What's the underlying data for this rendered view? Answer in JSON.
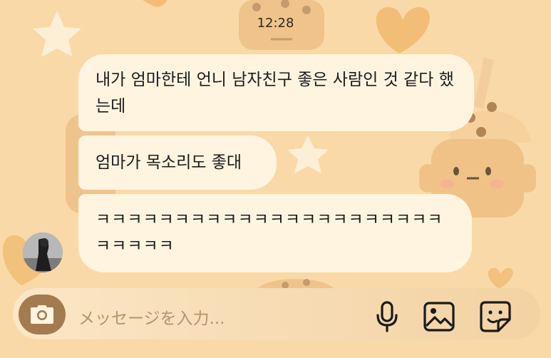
{
  "status": {
    "time": "12:28"
  },
  "messages": [
    {
      "text": "내가 엄마한테 언니 남자친구 좋은 사람인 것 같다 했는데"
    },
    {
      "text": "엄마가 목소리도 좋대"
    },
    {
      "text": "ㅋㅋㅋㅋㅋㅋㅋㅋㅋㅋㅋㅋㅋㅋㅋㅋㅋㅋㅋㅋㅋㅋㅋㅋㅋㅋㅋ"
    }
  ],
  "composer": {
    "placeholder": "メッセージを入力...",
    "icons": [
      "camera-icon",
      "microphone-icon",
      "gallery-icon",
      "sticker-icon"
    ]
  },
  "colors": {
    "background": "#f9d9a8",
    "bubble": "#fff4df",
    "camera_button": "#a47a4f",
    "placeholder": "#b4946c"
  }
}
